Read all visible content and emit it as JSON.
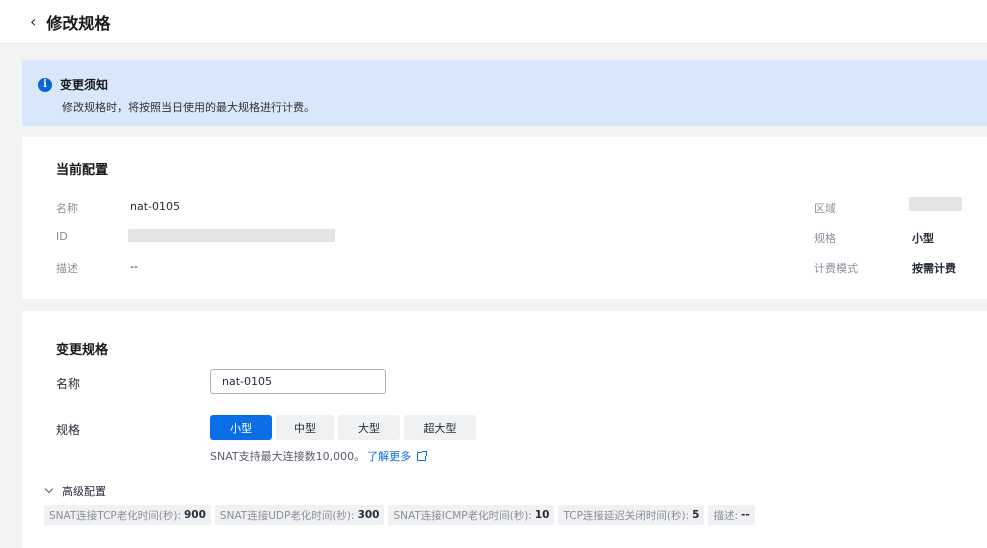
{
  "header": {
    "back_icon": "chevron-left-icon",
    "title": "修改规格"
  },
  "notice": {
    "icon": "info-icon",
    "title": "变更须知",
    "body": "修改规格时，将按照当日使用的最大规格进行计费。"
  },
  "current": {
    "title": "当前配置",
    "name_label": "名称",
    "name_value": "nat-0105",
    "id_label": "ID",
    "desc_label": "描述",
    "desc_value": "--",
    "region_label": "区域",
    "spec_label": "规格",
    "spec_value": "小型",
    "billing_label": "计费模式",
    "billing_value": "按需计费"
  },
  "change": {
    "title": "变更规格",
    "name_label": "名称",
    "name_value": "nat-0105",
    "spec_label": "规格",
    "specs": [
      "小型",
      "中型",
      "大型",
      "超大型"
    ],
    "selected_spec": "小型",
    "hint": "SNAT支持最大连接数10,000。",
    "learn_more": "了解更多",
    "advanced_label": "高级配置",
    "tags": [
      {
        "label": "SNAT连接TCP老化时间(秒):",
        "value": "900"
      },
      {
        "label": "SNAT连接UDP老化时间(秒):",
        "value": "300"
      },
      {
        "label": "SNAT连接ICMP老化时间(秒):",
        "value": "10"
      },
      {
        "label": "TCP连接延迟关闭时间(秒):",
        "value": "5"
      },
      {
        "label": "描述:",
        "value": "--"
      }
    ]
  },
  "colors": {
    "primary": "#0a6ee6",
    "notice_bg": "#d9e7fc",
    "page_bg": "#f2f3f5"
  }
}
